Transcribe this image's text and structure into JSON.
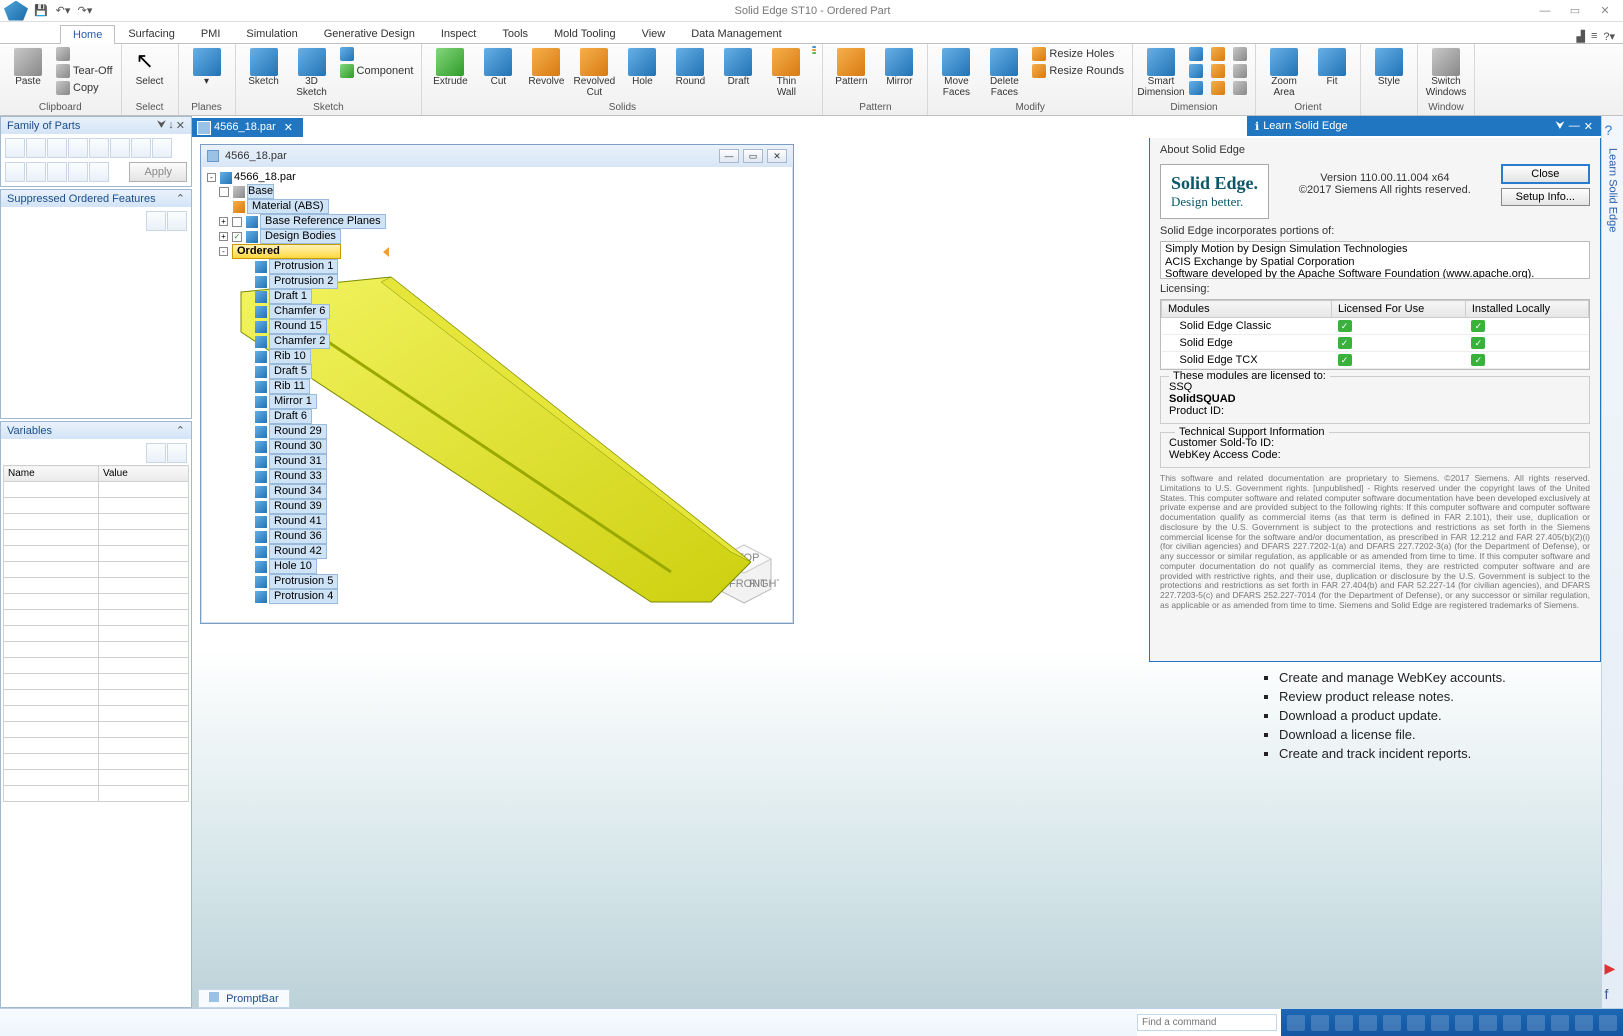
{
  "app": {
    "title": "Solid Edge ST10 - Ordered Part"
  },
  "tabs": [
    "Home",
    "Surfacing",
    "PMI",
    "Simulation",
    "Generative Design",
    "Inspect",
    "Tools",
    "Mold Tooling",
    "View",
    "Data Management"
  ],
  "active_tab": "Home",
  "ribbon": {
    "clipboard": {
      "label": "Clipboard",
      "paste": "Paste",
      "tearoff": "Tear-Off",
      "copy": "Copy"
    },
    "select": {
      "label": "Select",
      "select": "Select"
    },
    "planes": {
      "label": "Planes"
    },
    "sketch": {
      "label": "Sketch",
      "sketch": "Sketch",
      "sk3d": "3D\nSketch",
      "component": "Component"
    },
    "solids": {
      "label": "Solids",
      "items": [
        "Extrude",
        "Cut",
        "Revolve",
        "Revolved\nCut",
        "Hole",
        "Round",
        "Draft",
        "Thin\nWall"
      ]
    },
    "pattern": {
      "label": "Pattern",
      "items": [
        "Pattern",
        "Mirror"
      ]
    },
    "modify": {
      "label": "Modify",
      "items": [
        "Move\nFaces",
        "Delete\nFaces"
      ],
      "resize_holes": "Resize Holes",
      "resize_rounds": "Resize Rounds"
    },
    "dimension": {
      "label": "Dimension",
      "smart": "Smart\nDimension"
    },
    "zoom": "Zoom\nArea",
    "fit": "Fit",
    "orient": "Orient",
    "style": "Style",
    "window": {
      "label": "Window",
      "switch": "Switch\nWindows"
    }
  },
  "family_panel": {
    "title": "Family of Parts",
    "apply": "Apply"
  },
  "suppressed_panel": {
    "title": "Suppressed Ordered Features"
  },
  "variables_panel": {
    "title": "Variables",
    "cols": [
      "Name",
      "Value"
    ]
  },
  "document": {
    "tab": "4566_18.par",
    "window_title": "4566_18.par"
  },
  "feature_tree": {
    "root": "4566_18.par",
    "base": "Base",
    "material": "Material (ABS)",
    "ref_planes": "Base Reference Planes",
    "design_bodies": "Design Bodies",
    "ordered": "Ordered",
    "features": [
      "Protrusion 1",
      "Protrusion 2",
      "Draft 1",
      "Chamfer 6",
      "Round 15",
      "Chamfer 2",
      "Rib 10",
      "Draft 5",
      "Rib 11",
      "Mirror 1",
      "Draft 6",
      "Round 29",
      "Round 30",
      "Round 31",
      "Round 33",
      "Round 34",
      "Round 39",
      "Round 41",
      "Round 36",
      "Round 42",
      "Hole 10",
      "Protrusion 5",
      "Protrusion 4"
    ]
  },
  "learn_panel": {
    "title": "Learn Solid Edge",
    "items": [
      "Create and manage WebKey accounts.",
      "Review product release notes.",
      "Download a product update.",
      "Download a license file.",
      "Create and track incident reports."
    ]
  },
  "about": {
    "title": "About Solid Edge",
    "logo1": "Solid Edge.",
    "logo2": "Design better.",
    "version": "Version 110.00.11.004 x64",
    "copyright": "©2017 Siemens All rights reserved.",
    "close": "Close",
    "setup": "Setup Info...",
    "incorp": "Solid Edge incorporates portions of:",
    "portions": [
      "Simply Motion by Design Simulation Technologies",
      "ACIS Exchange by Spatial Corporation",
      "Software developed by the Apache Software Foundation (www.apache.org)."
    ],
    "licensing": "Licensing:",
    "cols": [
      "Modules",
      "Licensed For Use",
      "Installed Locally"
    ],
    "modules": [
      "Solid Edge Classic",
      "Solid Edge",
      "Solid Edge TCX"
    ],
    "licensed_to_label": "These modules are licensed to:",
    "licensee1": "SSQ",
    "licensee2": "SolidSQUAD",
    "product_id": "Product ID:",
    "tech": "Technical Support Information",
    "sold_to": "Customer Sold-To ID:",
    "webkey": "WebKey Access Code:",
    "legal": "This software and related documentation are proprietary to Siemens. ©2017 Siemens. All rights reserved. Limitations to U.S. Government rights. [unpublished] - Rights reserved under the copyright laws of the United States. This computer software and related computer software documentation have been developed exclusively at private expense and are provided subject to the following rights: If this computer software and computer software documentation qualify as commercial items (as that term is defined in FAR 2.101), their use, duplication or disclosure by the U.S. Government is subject to the protections and restrictions as set forth in the Siemens commercial license for the software and/or documentation, as prescribed in FAR 12.212 and FAR 27.405(b)(2)(i) (for civilian agencies) and DFARS 227.7202-1(a) and DFARS 227.7202-3(a) (for the Department of Defense), or any successor or similar regulation, as applicable or as amended from time to time. If this computer software and computer documentation do not qualify as commercial items, they are restricted computer software and are provided with restrictive rights, and their use, duplication or disclosure by the U.S. Government is subject to the protections and restrictions as set forth in FAR 27.404(b) and FAR 52.227-14 (for civilian agencies), and DFARS 227.7203-5(c) and DFARS 252.227-7014 (for the Department of Defense), or any successor or similar regulation, as applicable or as amended from time to time. Siemens and Solid Edge are registered trademarks of Siemens."
  },
  "statusbar": {
    "prompt_tab": "PromptBar",
    "find_placeholder": "Find a command"
  },
  "right_sidebar_label": "Learn Solid Edge",
  "viewcube": {
    "front": "FRONT",
    "right": "RIGHT",
    "top": "TOP"
  }
}
